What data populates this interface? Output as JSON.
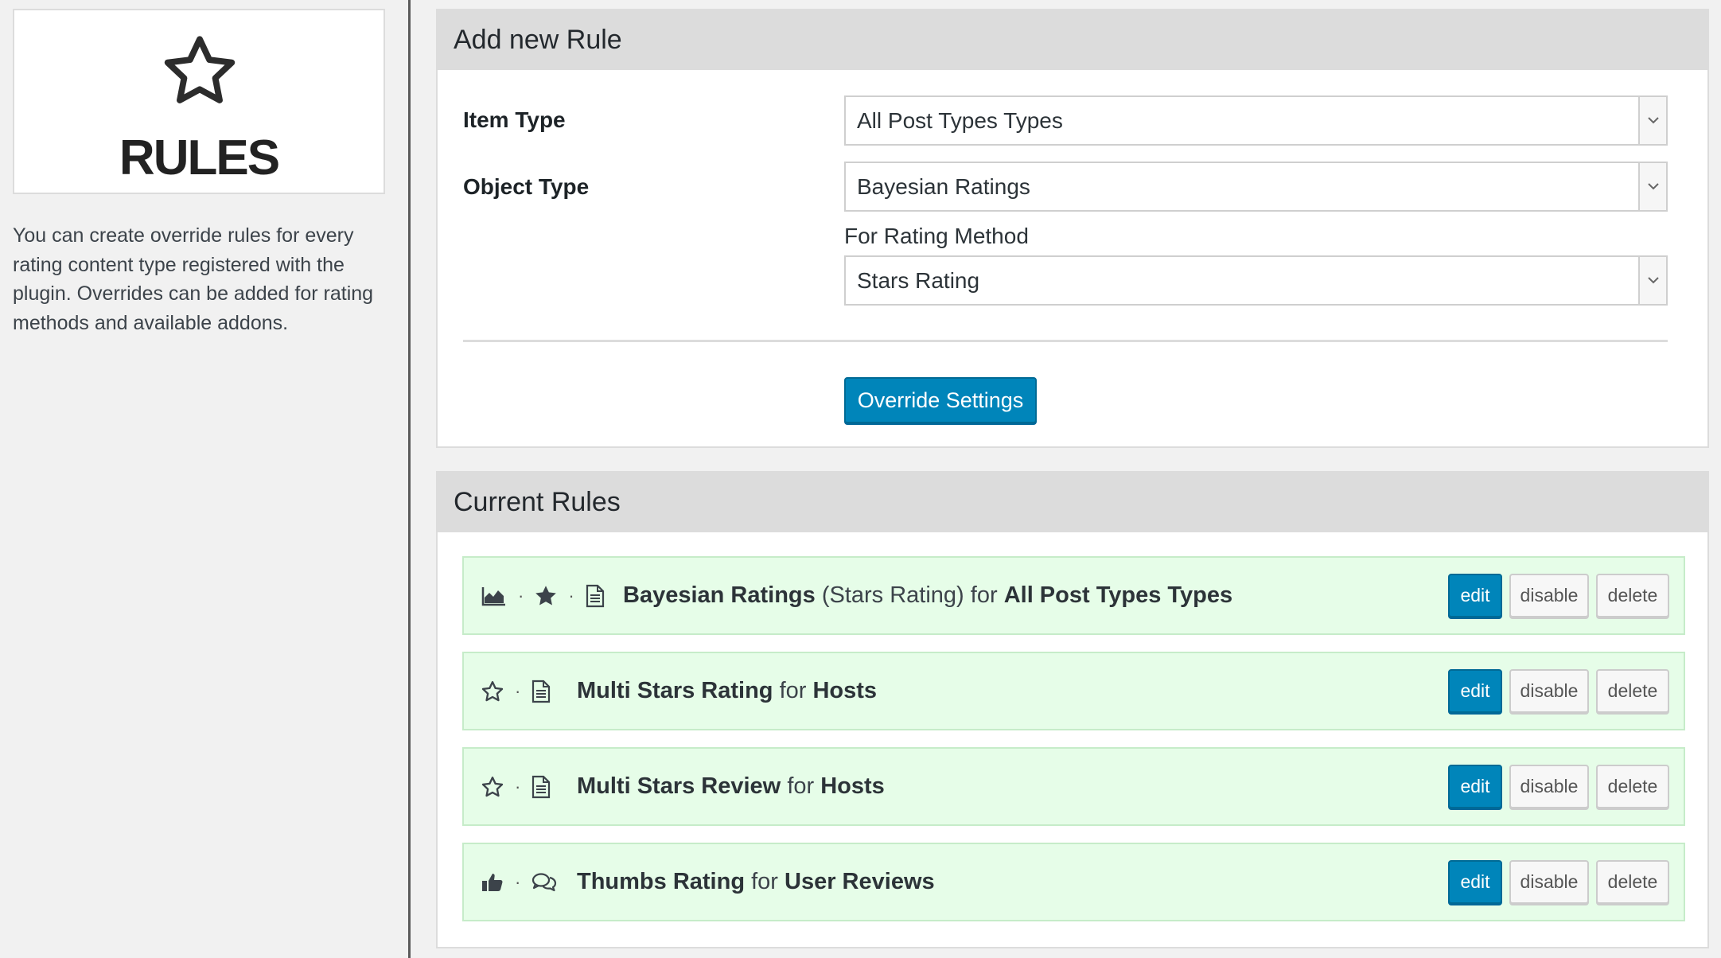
{
  "sidebar": {
    "logo_icon": "star-outline-icon",
    "title": "RULES",
    "description": "You can create override rules for every rating content type registered with the plugin. Overrides can be added for rating methods and available addons."
  },
  "add_rule": {
    "heading": "Add new Rule",
    "item_type_label": "Item Type",
    "item_type_value": "All Post Types Types",
    "object_type_label": "Object Type",
    "object_type_value": "Bayesian Ratings",
    "rating_method_label": "For Rating Method",
    "rating_method_value": "Stars Rating",
    "submit_label": "Override Settings"
  },
  "current_rules": {
    "heading": "Current Rules",
    "rules": [
      {
        "icons": [
          "chart-area-icon",
          "star-filled-icon",
          "document-icon"
        ],
        "name": "Bayesian Ratings",
        "method": "(Stars Rating)",
        "connector": "for",
        "target": "All Post Types Types"
      },
      {
        "icons": [
          "star-outline-icon",
          "document-icon"
        ],
        "name": "Multi Stars Rating",
        "connector": "for",
        "target": "Hosts"
      },
      {
        "icons": [
          "star-outline-icon",
          "document-icon"
        ],
        "name": "Multi Stars Review",
        "connector": "for",
        "target": "Hosts"
      },
      {
        "icons": [
          "thumbs-up-icon",
          "comments-icon"
        ],
        "name": "Thumbs Rating",
        "connector": "for",
        "target": "User Reviews"
      }
    ],
    "actions": {
      "edit_label": "edit",
      "disable_label": "disable",
      "delete_label": "delete"
    }
  },
  "colors": {
    "primary": "#0085ba",
    "rule_row_bg": "#e6fde8",
    "header_bg": "#dcdcdc"
  }
}
